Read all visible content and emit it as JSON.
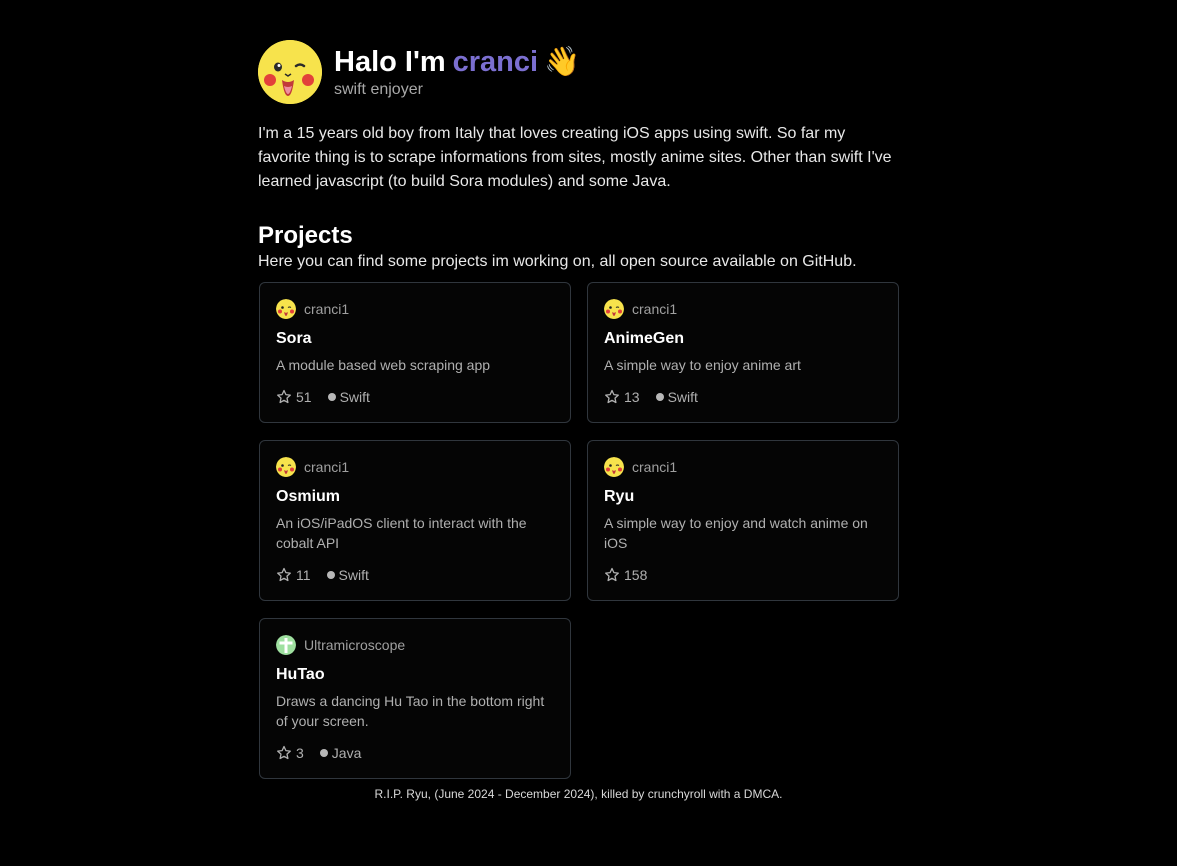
{
  "header": {
    "greeting": "Halo I'm",
    "name": "cranci",
    "wave": "👋",
    "subtitle": "swift enjoyer"
  },
  "bio": "I'm a 15 years old boy from Italy that loves creating iOS apps using swift. So far my favorite thing is to scrape informations from sites, mostly anime sites. Other than swift I've learned javascript (to build Sora modules) and some Java.",
  "projects": {
    "title": "Projects",
    "subtitle": "Here you can find some projects im working on, all open source available on GitHub.",
    "cards": [
      {
        "owner": "cranci1",
        "name": "Sora",
        "description": "A module based web scraping app",
        "stars": "51",
        "language": "Swift"
      },
      {
        "owner": "cranci1",
        "name": "AnimeGen",
        "description": "A simple way to enjoy anime art",
        "stars": "13",
        "language": "Swift"
      },
      {
        "owner": "cranci1",
        "name": "Osmium",
        "description": "An iOS/iPadOS client to interact with the cobalt API",
        "stars": "11",
        "language": "Swift"
      },
      {
        "owner": "cranci1",
        "name": "Ryu",
        "description": "A simple way to enjoy and watch anime on iOS",
        "stars": "158",
        "language": ""
      },
      {
        "owner": "Ultramicroscope",
        "name": "HuTao",
        "description": "Draws a dancing Hu Tao in the bottom right of your screen.",
        "stars": "3",
        "language": "Java"
      }
    ]
  },
  "footer": "R.I.P. Ryu, (June 2024 - December 2024), killed by crunchyroll with a DMCA.",
  "colors": {
    "background": "#000000",
    "accent_name": "#7b6fd0",
    "card_border": "#30363d"
  },
  "icons": {
    "avatar": "pikachu-avatar",
    "star": "star-icon",
    "wave": "waving-hand-emoji"
  }
}
